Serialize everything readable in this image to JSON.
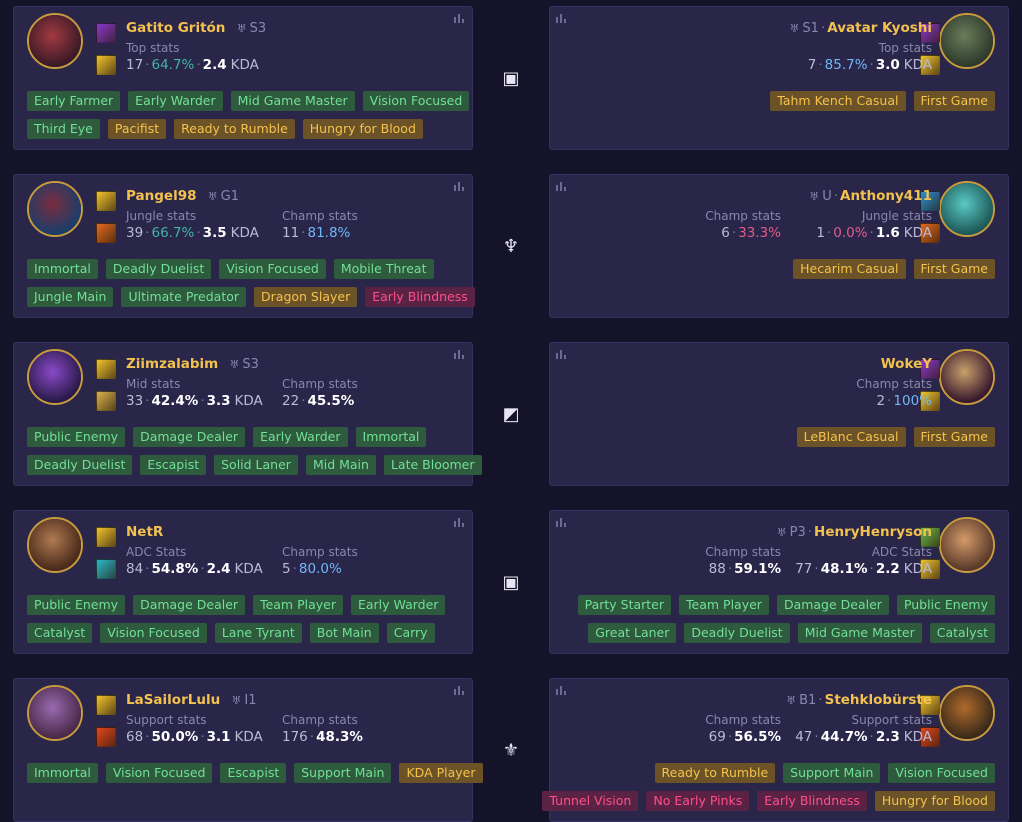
{
  "matchups": [
    {
      "role_icon": "top-lane-icon",
      "role_glyph": "▣",
      "left": {
        "name": "Gatito Gritón",
        "rank": "S3",
        "rank_icon": "silver-rank-icon",
        "avatar_colors": [
          "#3a1a26",
          "#a23a42"
        ],
        "spells": [
          "#8a37c9",
          "#f0c32e"
        ],
        "stats": [
          {
            "label": "Top stats",
            "games": "17",
            "winrate": "64.7%",
            "wr_class": "wr-green",
            "kda": "2.4"
          }
        ],
        "tags": [
          [
            {
              "t": "Early Farmer",
              "c": "green"
            },
            {
              "t": "Early Warder",
              "c": "green"
            },
            {
              "t": "Mid Game Master",
              "c": "green"
            },
            {
              "t": "Vision Focused",
              "c": "green"
            }
          ],
          [
            {
              "t": "Third Eye",
              "c": "green"
            },
            {
              "t": "Pacifist",
              "c": "gold"
            },
            {
              "t": "Ready to Rumble",
              "c": "gold"
            },
            {
              "t": "Hungry for Blood",
              "c": "gold"
            }
          ]
        ]
      },
      "right": {
        "name": "Avatar Kyoshi",
        "rank": "S1",
        "rank_icon": "silver-rank-icon",
        "avatar_colors": [
          "#2e3a2c",
          "#6a7d5a"
        ],
        "spells": [
          "#8a37c9",
          "#f0c32e"
        ],
        "stats": [
          {
            "label": "Top stats",
            "games": "7",
            "winrate": "85.7%",
            "wr_class": "wr-blue",
            "kda": "3.0"
          }
        ],
        "tags": [
          [
            {
              "t": "Tahm Kench Casual",
              "c": "gold"
            },
            {
              "t": "First Game",
              "c": "gold"
            }
          ]
        ]
      }
    },
    {
      "role_icon": "jungle-icon",
      "role_glyph": "♆",
      "left": {
        "name": "Pangel98",
        "rank": "G1",
        "rank_icon": "gold-rank-icon",
        "avatar_colors": [
          "#1c3d6a",
          "#7a2c3e"
        ],
        "spells": [
          "#f0c32e",
          "#e26a1e"
        ],
        "stats": [
          {
            "label": "Jungle stats",
            "games": "39",
            "winrate": "66.7%",
            "wr_class": "wr-green",
            "kda": "3.5"
          },
          {
            "label": "Champ stats",
            "games": "11",
            "winrate": "81.8%",
            "wr_class": "wr-blue",
            "kda": ""
          }
        ],
        "tags": [
          [
            {
              "t": "Immortal",
              "c": "green"
            },
            {
              "t": "Deadly Duelist",
              "c": "green"
            },
            {
              "t": "Vision Focused",
              "c": "green"
            },
            {
              "t": "Mobile Threat",
              "c": "green"
            }
          ],
          [
            {
              "t": "Jungle Main",
              "c": "green"
            },
            {
              "t": "Ultimate Predator",
              "c": "green"
            },
            {
              "t": "Dragon Slayer",
              "c": "gold"
            },
            {
              "t": "Early Blindness",
              "c": "red"
            }
          ]
        ]
      },
      "right": {
        "name": "Anthony411",
        "rank": "U",
        "rank_icon": "unranked-icon",
        "avatar_colors": [
          "#1d5a5a",
          "#5ac9c4"
        ],
        "spells": [
          "#2a8fd4",
          "#e26a1e"
        ],
        "stats": [
          {
            "label": "Champ stats",
            "games": "6",
            "winrate": "33.3%",
            "wr_class": "wr-red",
            "kda": ""
          },
          {
            "label": "Jungle stats",
            "games": "1",
            "winrate": "0.0%",
            "wr_class": "wr-red",
            "kda": "1.6",
            "kda_class": "wr-red"
          }
        ],
        "tags": [
          [
            {
              "t": "Hecarim Casual",
              "c": "gold"
            },
            {
              "t": "First Game",
              "c": "gold"
            }
          ]
        ]
      }
    },
    {
      "role_icon": "mid-lane-icon",
      "role_glyph": "◩",
      "left": {
        "name": "Ziimzalabim",
        "rank": "S3",
        "rank_icon": "silver-rank-icon",
        "avatar_colors": [
          "#2a1a4a",
          "#8a4ac9"
        ],
        "spells": [
          "#f0c32e",
          "#d8b24a"
        ],
        "stats": [
          {
            "label": "Mid stats",
            "games": "33",
            "winrate": "42.4%",
            "wr_class": "wr-white",
            "kda": "3.3"
          },
          {
            "label": "Champ stats",
            "games": "22",
            "winrate": "45.5%",
            "wr_class": "wr-white",
            "kda": ""
          }
        ],
        "tags": [
          [
            {
              "t": "Public Enemy",
              "c": "green"
            },
            {
              "t": "Damage Dealer",
              "c": "green"
            },
            {
              "t": "Early Warder",
              "c": "green"
            },
            {
              "t": "Immortal",
              "c": "green"
            }
          ],
          [
            {
              "t": "Deadly Duelist",
              "c": "green"
            },
            {
              "t": "Escapist",
              "c": "green"
            },
            {
              "t": "Solid Laner",
              "c": "green"
            },
            {
              "t": "Mid Main",
              "c": "green"
            },
            {
              "t": "Late Bloomer",
              "c": "green"
            }
          ]
        ]
      },
      "right": {
        "name": "WokeY",
        "rank": "",
        "rank_icon": "",
        "avatar_colors": [
          "#3a1a2e",
          "#c9a06a"
        ],
        "spells": [
          "#8a37c9",
          "#f0c32e"
        ],
        "stats": [
          {
            "label": "Champ stats",
            "games": "2",
            "winrate": "100%",
            "wr_class": "wr-blue",
            "kda": ""
          }
        ],
        "tags": [
          [
            {
              "t": "LeBlanc Casual",
              "c": "gold"
            },
            {
              "t": "First Game",
              "c": "gold"
            }
          ]
        ]
      }
    },
    {
      "role_icon": "bot-lane-icon",
      "role_glyph": "▣",
      "left": {
        "name": "NetR",
        "rank": "",
        "rank_icon": "",
        "avatar_colors": [
          "#4a2a1a",
          "#b07a52"
        ],
        "spells": [
          "#f0c32e",
          "#2ab8c9"
        ],
        "stats": [
          {
            "label": "ADC Stats",
            "games": "84",
            "winrate": "54.8%",
            "wr_class": "wr-white",
            "kda": "2.4"
          },
          {
            "label": "Champ stats",
            "games": "5",
            "winrate": "80.0%",
            "wr_class": "wr-blue",
            "kda": ""
          }
        ],
        "tags": [
          [
            {
              "t": "Public Enemy",
              "c": "green"
            },
            {
              "t": "Damage Dealer",
              "c": "green"
            },
            {
              "t": "Team Player",
              "c": "green"
            },
            {
              "t": "Early Warder",
              "c": "green"
            }
          ],
          [
            {
              "t": "Catalyst",
              "c": "green"
            },
            {
              "t": "Vision Focused",
              "c": "green"
            },
            {
              "t": "Lane Tyrant",
              "c": "green"
            },
            {
              "t": "Bot Main",
              "c": "green"
            },
            {
              "t": "Carry",
              "c": "green"
            }
          ]
        ]
      },
      "right": {
        "name": "HenryHenryson",
        "rank": "P3",
        "rank_icon": "platinum-rank-icon",
        "avatar_colors": [
          "#5a3a2a",
          "#d49a6a"
        ],
        "spells": [
          "#6ab84a",
          "#f0c32e"
        ],
        "stats": [
          {
            "label": "Champ stats",
            "games": "88",
            "winrate": "59.1%",
            "wr_class": "wr-white",
            "kda": ""
          },
          {
            "label": "ADC Stats",
            "games": "77",
            "winrate": "48.1%",
            "wr_class": "wr-white",
            "kda": "2.2"
          }
        ],
        "tags": [
          [
            {
              "t": "Party Starter",
              "c": "green"
            },
            {
              "t": "Team Player",
              "c": "green"
            },
            {
              "t": "Damage Dealer",
              "c": "green"
            },
            {
              "t": "Public Enemy",
              "c": "green"
            }
          ],
          [
            {
              "t": "Great Laner",
              "c": "green"
            },
            {
              "t": "Deadly Duelist",
              "c": "green"
            },
            {
              "t": "Mid Game Master",
              "c": "green"
            },
            {
              "t": "Catalyst",
              "c": "green"
            }
          ]
        ]
      }
    },
    {
      "role_icon": "support-icon",
      "role_glyph": "⚜",
      "left": {
        "name": "LaSailorLulu",
        "rank": "I1",
        "rank_icon": "iron-rank-icon",
        "avatar_colors": [
          "#4a2a4a",
          "#9a6ab0"
        ],
        "spells": [
          "#f0c32e",
          "#e2461e"
        ],
        "stats": [
          {
            "label": "Support stats",
            "games": "68",
            "winrate": "50.0%",
            "wr_class": "wr-white",
            "kda": "3.1"
          },
          {
            "label": "Champ stats",
            "games": "176",
            "winrate": "48.3%",
            "wr_class": "wr-white",
            "kda": ""
          }
        ],
        "tags": [
          [
            {
              "t": "Immortal",
              "c": "green"
            },
            {
              "t": "Vision Focused",
              "c": "green"
            },
            {
              "t": "Escapist",
              "c": "green"
            },
            {
              "t": "Support Main",
              "c": "green"
            },
            {
              "t": "KDA Player",
              "c": "gold"
            }
          ]
        ]
      },
      "right": {
        "name": "Stehklobürste",
        "rank": "B1",
        "rank_icon": "bronze-rank-icon",
        "avatar_colors": [
          "#3a2a1a",
          "#b06a2a"
        ],
        "spells": [
          "#f0c32e",
          "#e2461e"
        ],
        "stats": [
          {
            "label": "Champ stats",
            "games": "69",
            "winrate": "56.5%",
            "wr_class": "wr-white",
            "kda": ""
          },
          {
            "label": "Support stats",
            "games": "47",
            "winrate": "44.7%",
            "wr_class": "wr-white",
            "kda": "2.3"
          }
        ],
        "tags": [
          [
            {
              "t": "Ready to Rumble",
              "c": "gold"
            },
            {
              "t": "Support Main",
              "c": "green"
            },
            {
              "t": "Vision Focused",
              "c": "green"
            }
          ],
          [
            {
              "t": "Tunnel Vision",
              "c": "red"
            },
            {
              "t": "No Early Pinks",
              "c": "red"
            },
            {
              "t": "Early Blindness",
              "c": "red"
            },
            {
              "t": "Hungry for Blood",
              "c": "gold"
            }
          ]
        ]
      }
    }
  ],
  "labels": {
    "kda_suffix": "KDA",
    "rank_separator": "·"
  }
}
